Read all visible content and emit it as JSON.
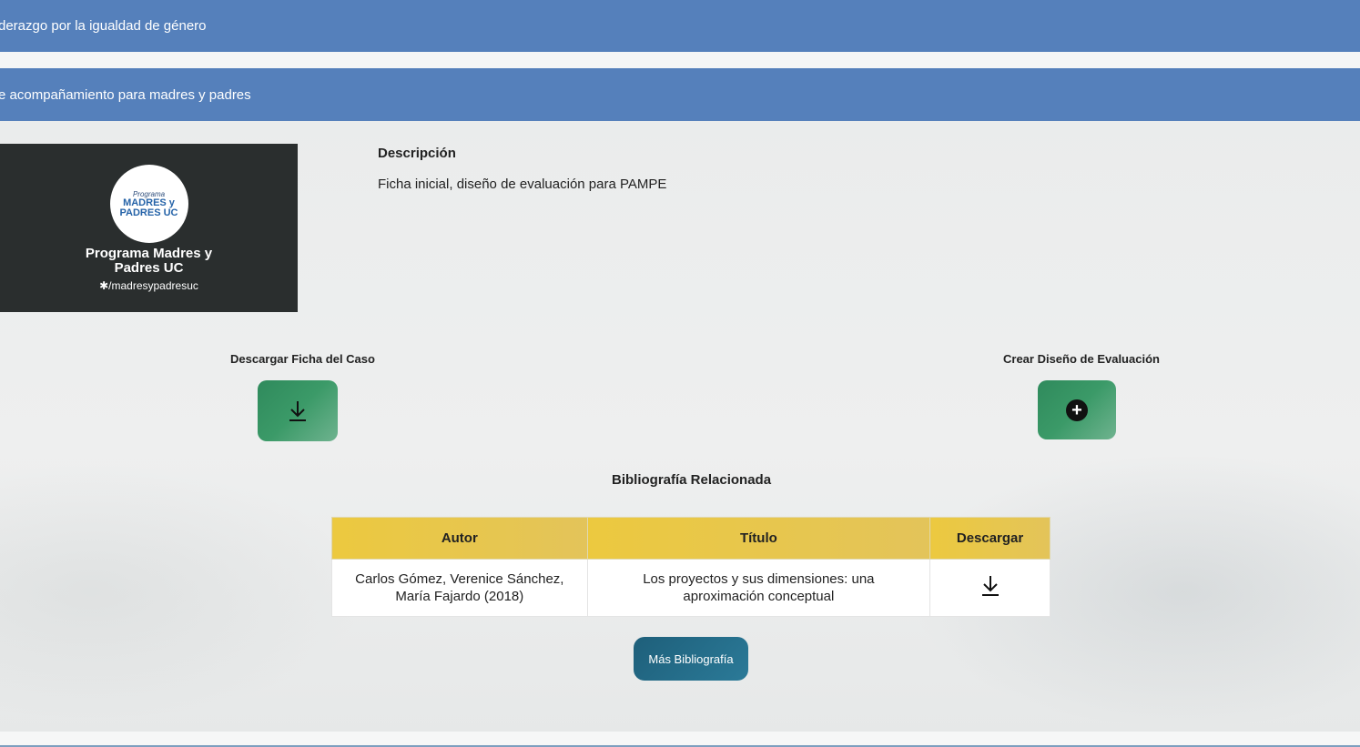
{
  "header": {
    "bar1_text": "derazgo por la igualdad de género",
    "bar2_text": "e acompañamiento para madres y padres"
  },
  "logo": {
    "circle_small": "Programa",
    "circle_main": "MADRES y PADRES UC",
    "title": "Programa Madres y Padres UC",
    "handle": "✱/madresypadresuc"
  },
  "description": {
    "label": "Descripción",
    "text": "Ficha inicial, diseño de evaluación para PAMPE"
  },
  "actions": {
    "download_label": "Descargar Ficha del Caso",
    "create_label": "Crear Diseño de Evaluación",
    "create_symbol": "+"
  },
  "bibliography": {
    "title": "Bibliografía Relacionada",
    "columns": [
      "Autor",
      "Título",
      "Descargar"
    ],
    "rows": [
      {
        "author": "Carlos Gómez, Verenice Sánchez, María Fajardo (2018)",
        "title": "Los proyectos y sus dimensiones: una aproximación conceptual"
      }
    ],
    "more_button": "Más Bibliografía"
  },
  "colors": {
    "header_bar": "#5580bb",
    "green_button": "#3b9a68",
    "table_header": "#ecc93f",
    "more_button": "#1e5f7a"
  }
}
